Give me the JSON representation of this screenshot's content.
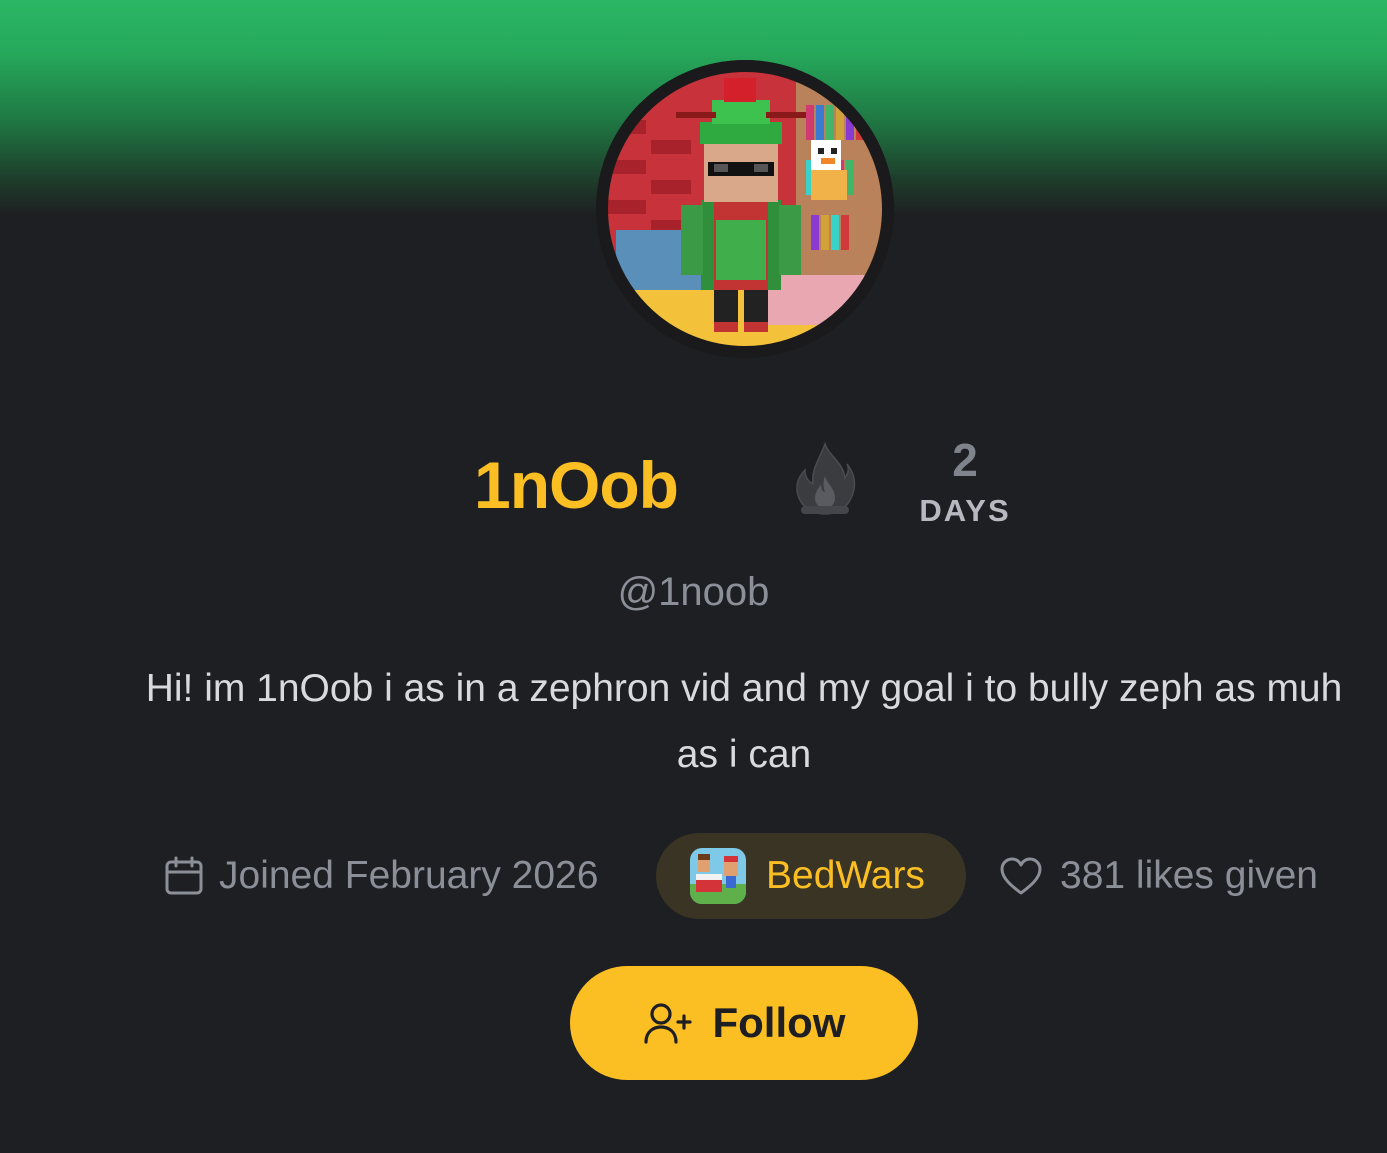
{
  "profile": {
    "display_name": "1nOob",
    "handle": "@1noob",
    "bio": "Hi! im 1nOob i as in a zephron vid and my goal i to bully zeph as muh as i can",
    "avatar_icon": "avatar-image"
  },
  "streak": {
    "count": "2",
    "unit": "DAYS",
    "icon": "flame-icon"
  },
  "meta": {
    "joined": "Joined February 2026",
    "joined_icon": "calendar-icon",
    "game": "BedWars",
    "game_icon": "bedwars-thumbnail",
    "likes": "381 likes given",
    "likes_icon": "heart-icon"
  },
  "actions": {
    "follow_label": "Follow",
    "follow_icon": "user-plus-icon"
  },
  "colors": {
    "accent": "#fbbf24",
    "background": "#1e1f22",
    "banner": "#2ab764",
    "muted_text": "#8b8f97"
  }
}
